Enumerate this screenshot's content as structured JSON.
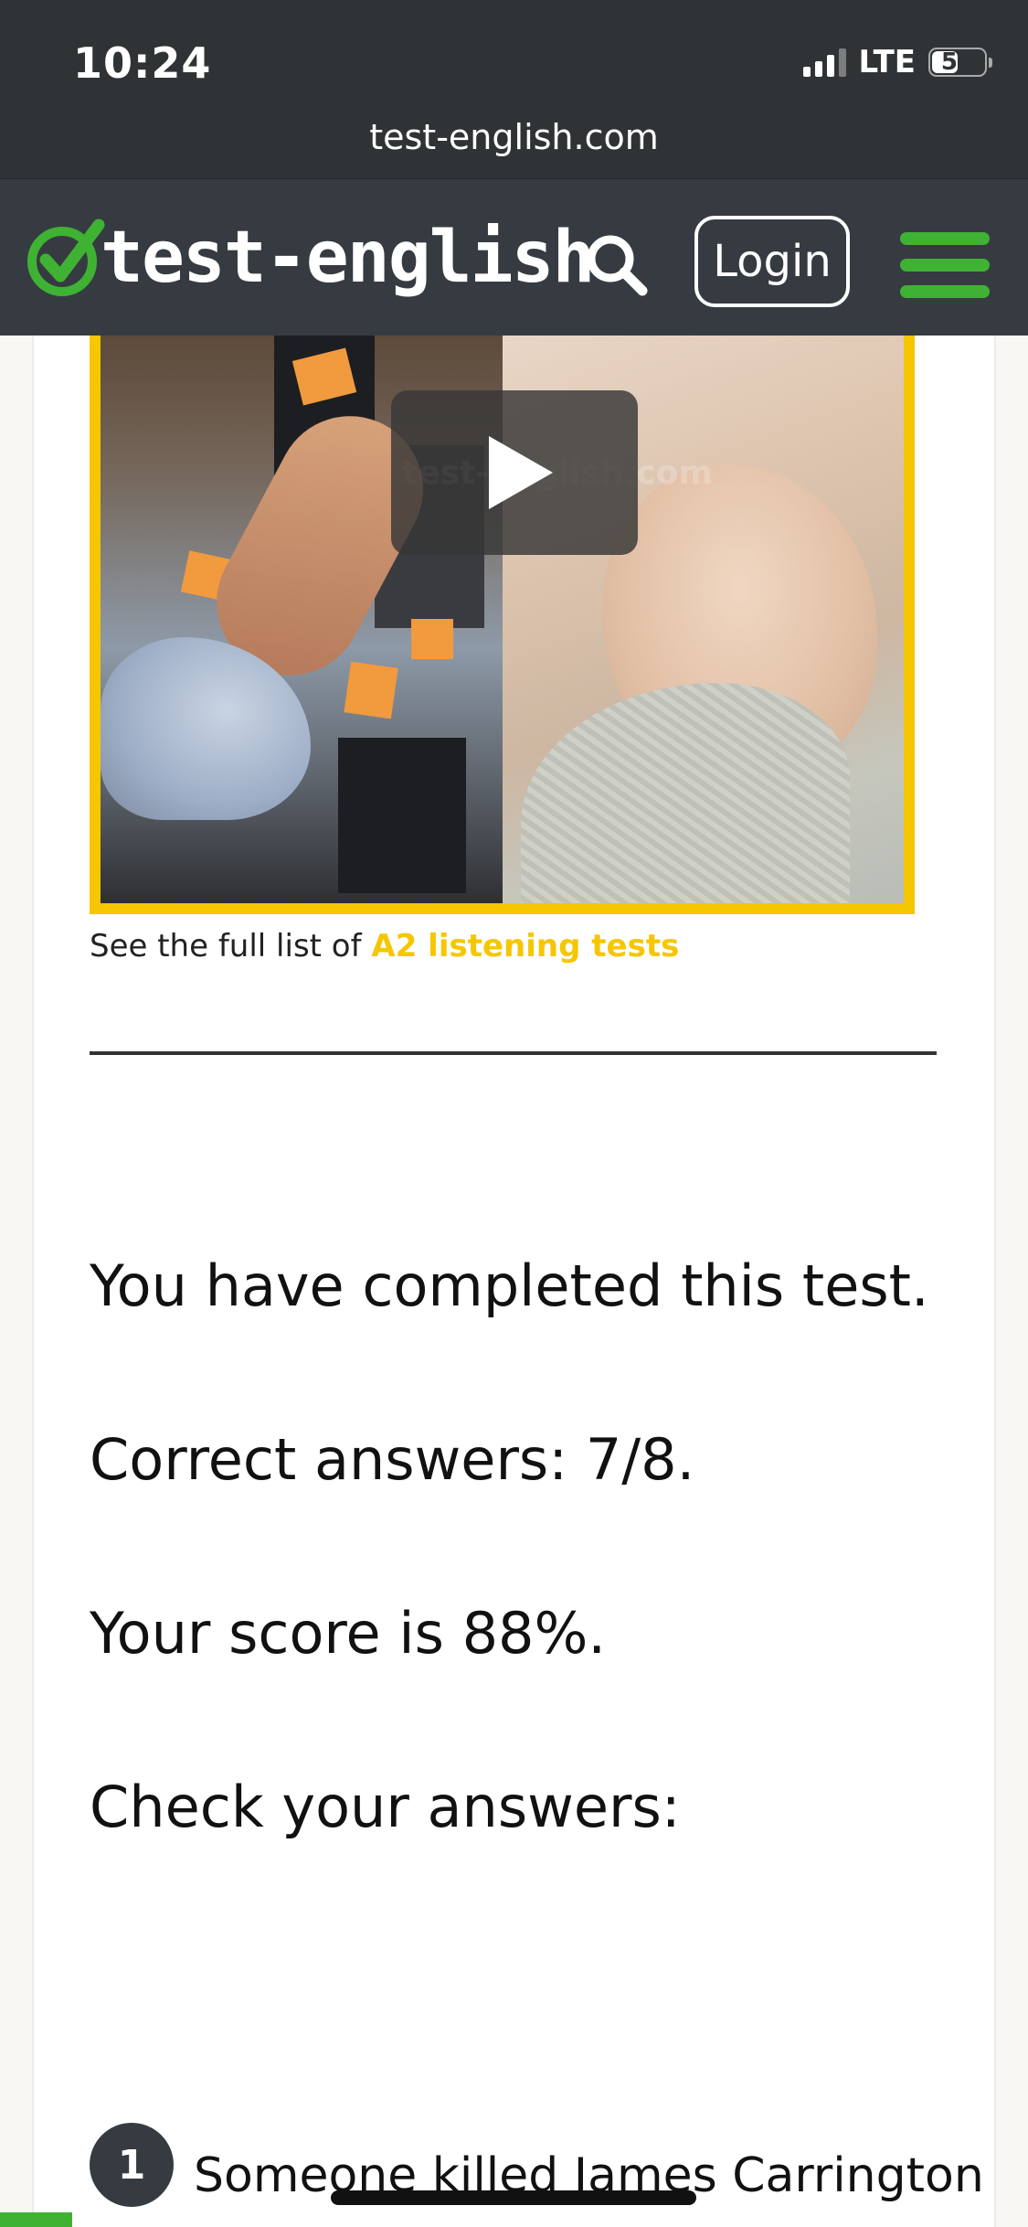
{
  "status_bar": {
    "time": "10:24",
    "network": "LTE",
    "battery": "50",
    "battery_fraction": 0.5
  },
  "browser": {
    "url": "test-english.com"
  },
  "header": {
    "logo_text": "test-english",
    "logo_icon": "check-circle-icon",
    "search_icon": "search-icon",
    "login_label": "Login",
    "menu_icon": "hamburger-menu-icon",
    "accent_color": "#3fb233"
  },
  "video": {
    "watermark": "test-english.com",
    "play_icon": "play-icon",
    "frame_color": "#f6c600"
  },
  "full_list": {
    "prefix": "See the full list of ",
    "link_text": "A2 listening tests",
    "link_color": "#f6c600"
  },
  "results": {
    "completed": "You have completed this test.",
    "correct": "Correct answers: 7/8.",
    "score": "Your score is 88%.",
    "check": "Check your answers:"
  },
  "questions": [
    {
      "number": "1",
      "text": "Someone killed James Carrington"
    }
  ],
  "page_progress": 0.07
}
